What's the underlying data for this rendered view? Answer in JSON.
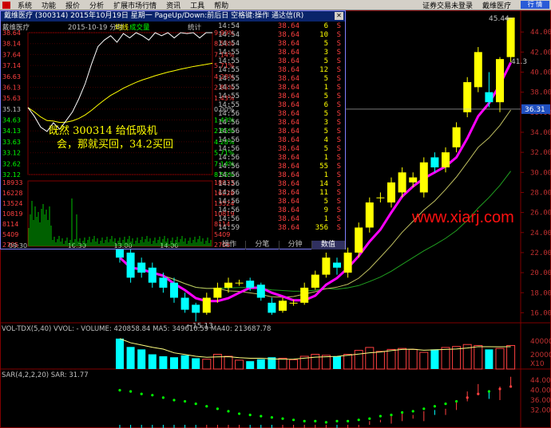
{
  "menu": {
    "items": [
      "系统",
      "功能",
      "报价",
      "分析",
      "扩展市场行情",
      "资讯",
      "工具",
      "帮助"
    ],
    "right_items": [
      "证券交易未登录",
      "戴维医疗"
    ],
    "hq_button": "行 情"
  },
  "popup": {
    "title": "戴维医疗 (300314)  2015年10月19日 星期一  PageUp/Down:前后日 空格键:操作 通达信(R)",
    "inner_name": "戴维医疗",
    "date_line": "2015-10-19 分时",
    "avg_label": "均线",
    "vol_label": "成交量",
    "stat_label": "统计",
    "price_ticks": [
      "38.64",
      "38.14",
      "37.64",
      "37.14",
      "36.63",
      "36.13",
      "35.63",
      "35.13",
      "34.63",
      "34.13",
      "33.63",
      "33.12",
      "32.62",
      "32.12"
    ],
    "pct_ticks": [
      "9.99%",
      "8.56%",
      "7.14%",
      "5.71%",
      "4.28%",
      "2.85%",
      "1.43%",
      "0.00%",
      "1.43%",
      "2.85%",
      "4.28%",
      "5.71%",
      "7.14%",
      "8.56%"
    ],
    "vol_ticks": [
      "18933",
      "16228",
      "13524",
      "10819",
      "8114",
      "5409",
      "2705"
    ],
    "time_ticks": [
      "09:30",
      "10:30",
      "13:00",
      "14:00"
    ],
    "trades": [
      {
        "t": "14:54",
        "p": "38.64",
        "v": "6",
        "d": "S"
      },
      {
        "t": "14:54",
        "p": "38.64",
        "v": "10",
        "d": "S"
      },
      {
        "t": "14:54",
        "p": "38.64",
        "v": "5",
        "d": "S"
      },
      {
        "t": "14:55",
        "p": "38.64",
        "v": "3",
        "d": "S"
      },
      {
        "t": "14:55",
        "p": "38.64",
        "v": "5",
        "d": "S"
      },
      {
        "t": "14:55",
        "p": "38.64",
        "v": "12",
        "d": "S"
      },
      {
        "t": "14:55",
        "p": "38.64",
        "v": "5",
        "d": "S"
      },
      {
        "t": "14:55",
        "p": "38.64",
        "v": "1",
        "d": "S"
      },
      {
        "t": "14:55",
        "p": "38.64",
        "v": "5",
        "d": "S"
      },
      {
        "t": "14:55",
        "p": "38.64",
        "v": "6",
        "d": "S"
      },
      {
        "t": "14:56",
        "p": "38.64",
        "v": "5",
        "d": "S"
      },
      {
        "t": "14:56",
        "p": "38.64",
        "v": "3",
        "d": "S"
      },
      {
        "t": "14:56",
        "p": "38.64",
        "v": "5",
        "d": "S"
      },
      {
        "t": "14:56",
        "p": "38.64",
        "v": "4",
        "d": "S"
      },
      {
        "t": "14:56",
        "p": "38.64",
        "v": "5",
        "d": "S"
      },
      {
        "t": "14:56",
        "p": "38.64",
        "v": "1",
        "d": "S"
      },
      {
        "t": "14:56",
        "p": "38.64",
        "v": "55",
        "d": "S"
      },
      {
        "t": "14:56",
        "p": "38.64",
        "v": "1",
        "d": "S"
      },
      {
        "t": "14:56",
        "p": "38.64",
        "v": "14",
        "d": "S"
      },
      {
        "t": "14:56",
        "p": "38.64",
        "v": "11",
        "d": "S"
      },
      {
        "t": "14:56",
        "p": "38.64",
        "v": "5",
        "d": "S"
      },
      {
        "t": "14:56",
        "p": "38.64",
        "v": "9",
        "d": "S"
      },
      {
        "t": "14:56",
        "p": "38.64",
        "v": "1",
        "d": "S"
      },
      {
        "t": "14:59",
        "p": "38.64",
        "v": "356",
        "d": "S"
      }
    ],
    "tabs": [
      "操作",
      "分笔",
      "分钟",
      "数值"
    ],
    "annotation_line1": "既然 300314 给低吸机",
    "annotation_line2": "会，那就买回，34.2买回"
  },
  "kline": {
    "y_ticks": [
      "44.00",
      "42.00",
      "40.00",
      "38.00",
      "36.00",
      "34.00",
      "32.00",
      "30.00",
      "28.00",
      "26.00",
      "24.00",
      "22.00",
      "20.00",
      "18.00",
      "16.00"
    ],
    "high_label": "45.44",
    "low_label": "15.13",
    "cur_label": "36.31",
    "small_label": "41.3",
    "watermark": "www.xiarj.com",
    "colors": {
      "up": "#ffff00",
      "down": "#00ffff",
      "ma_fast": "#ff00ff",
      "ma_mid": "#c0c060",
      "ma_slow": "#20a020"
    }
  },
  "volume": {
    "label": "VOL-TDX(5,40) VVOL: - VOLUME: 420858.84 MA5: 349610.59 MA40: 213687.78",
    "ticks": [
      "40000",
      "20000",
      "X10"
    ]
  },
  "sar": {
    "label": "SAR(4,2,2,20) SAR: 31.77",
    "ticks": [
      "44.00",
      "40.00",
      "36.00",
      "32.00"
    ]
  },
  "chart_data": {
    "type": "candlestick",
    "title": "戴维医疗 (300314)",
    "candles": [
      {
        "o": 23.0,
        "c": 21.5,
        "h": 24.0,
        "l": 21.0
      },
      {
        "o": 22.0,
        "c": 19.5,
        "h": 22.5,
        "l": 19.0
      },
      {
        "o": 21.0,
        "c": 20.0,
        "h": 21.5,
        "l": 19.5
      },
      {
        "o": 20.5,
        "c": 19.0,
        "h": 21.0,
        "l": 18.5
      },
      {
        "o": 19.5,
        "c": 18.5,
        "h": 20.0,
        "l": 18.0
      },
      {
        "o": 19.0,
        "c": 17.5,
        "h": 19.5,
        "l": 17.0
      },
      {
        "o": 17.5,
        "c": 16.3,
        "h": 18.0,
        "l": 16.0
      },
      {
        "o": 16.8,
        "c": 16.0,
        "h": 17.0,
        "l": 15.13
      },
      {
        "o": 16.0,
        "c": 17.5,
        "h": 18.0,
        "l": 15.8
      },
      {
        "o": 17.5,
        "c": 18.5,
        "h": 19.0,
        "l": 17.0
      },
      {
        "o": 18.5,
        "c": 19.0,
        "h": 19.5,
        "l": 18.0
      },
      {
        "o": 19.0,
        "c": 19.0,
        "h": 19.3,
        "l": 18.7
      },
      {
        "o": 19.2,
        "c": 18.5,
        "h": 19.5,
        "l": 18.2
      },
      {
        "o": 18.8,
        "c": 17.5,
        "h": 19.0,
        "l": 17.2
      },
      {
        "o": 17.0,
        "c": 16.0,
        "h": 17.5,
        "l": 15.8
      },
      {
        "o": 16.2,
        "c": 17.2,
        "h": 17.5,
        "l": 16.0
      },
      {
        "o": 17.0,
        "c": 17.0,
        "h": 17.3,
        "l": 16.7
      },
      {
        "o": 17.0,
        "c": 18.5,
        "h": 19.0,
        "l": 16.8
      },
      {
        "o": 18.5,
        "c": 19.8,
        "h": 20.2,
        "l": 18.3
      },
      {
        "o": 19.8,
        "c": 21.5,
        "h": 22.0,
        "l": 19.5
      },
      {
        "o": 21.0,
        "c": 20.5,
        "h": 21.5,
        "l": 19.8
      },
      {
        "o": 20.0,
        "c": 22.0,
        "h": 22.5,
        "l": 19.5
      },
      {
        "o": 22.0,
        "c": 24.5,
        "h": 25.0,
        "l": 21.5
      },
      {
        "o": 24.5,
        "c": 27.0,
        "h": 27.5,
        "l": 24.0
      },
      {
        "o": 27.5,
        "c": 27.5,
        "h": 28.0,
        "l": 27.0
      },
      {
        "o": 27.0,
        "c": 29.0,
        "h": 29.5,
        "l": 26.5
      },
      {
        "o": 28.0,
        "c": 30.0,
        "h": 30.5,
        "l": 27.5
      },
      {
        "o": 29.0,
        "c": 29.5,
        "h": 30.0,
        "l": 28.5
      },
      {
        "o": 28.0,
        "c": 31.0,
        "h": 31.5,
        "l": 27.5
      },
      {
        "o": 31.5,
        "c": 30.5,
        "h": 32.0,
        "l": 30.0
      },
      {
        "o": 30.5,
        "c": 32.0,
        "h": 32.5,
        "l": 30.0
      },
      {
        "o": 32.5,
        "c": 34.5,
        "h": 35.0,
        "l": 32.0
      },
      {
        "o": 36.0,
        "c": 39.0,
        "h": 39.5,
        "l": 35.5
      },
      {
        "o": 38.5,
        "c": 42.0,
        "h": 42.5,
        "l": 38.0
      },
      {
        "o": 38.0,
        "c": 37.0,
        "h": 40.0,
        "l": 36.5
      },
      {
        "o": 37.0,
        "c": 41.3,
        "h": 41.5,
        "l": 36.0
      },
      {
        "o": 41.5,
        "c": 45.44,
        "h": 45.44,
        "l": 41.0
      }
    ],
    "ylim": [
      15,
      46
    ],
    "volume": [
      62000,
      45000,
      40000,
      30000,
      26000,
      24000,
      28000,
      22000,
      20000,
      30000,
      26000,
      18000,
      16000,
      20000,
      24000,
      22000,
      19000,
      26000,
      30000,
      28000,
      26000,
      30000,
      38000,
      44000,
      36000,
      40000,
      42000,
      40000,
      34000,
      40000,
      44000,
      46000,
      50000,
      48000,
      40000,
      42000,
      48000
    ],
    "sar": [
      40.0,
      39.5,
      38.5,
      38.0,
      37.0,
      36.0,
      35.5,
      34.5,
      33.5,
      32.5,
      31.5,
      30.5,
      30.0,
      29.5,
      29.0,
      28.5,
      28.0,
      27.5,
      27.5,
      27.0,
      27.5,
      27.5,
      28.0,
      28.5,
      29.5,
      30.0,
      31.0,
      31.5,
      32.5,
      33.5,
      34.5,
      35.5,
      37.0,
      38.5,
      39.5,
      40.5,
      41.5
    ]
  }
}
